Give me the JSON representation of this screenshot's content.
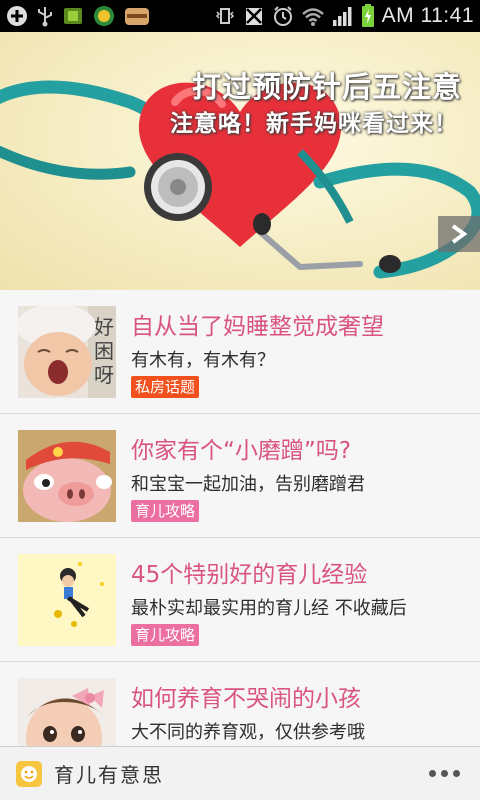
{
  "status_bar": {
    "time": "AM 11:41",
    "icons": [
      "add-icon",
      "usb-icon",
      "sim-icon",
      "app-notification-icon",
      "sandwich-app-icon",
      "vibrate-icon",
      "no-sim-icon",
      "alarm-icon",
      "wifi-icon",
      "signal-icon",
      "battery-charging-icon"
    ]
  },
  "banner": {
    "title": "打过预防针后五注意",
    "subtitle": "注意咯！新手妈咪看过来！",
    "next_icon": "chevron-right-icon"
  },
  "articles": [
    {
      "title": "自从当了妈睡整觉成奢望",
      "desc": "有木有，有木有？",
      "tag": "私房话题",
      "tag_color": "#f2501c",
      "thumb": "yawning-baby"
    },
    {
      "title": "你家有个“小磨蹭”吗?",
      "desc": "和宝宝一起加油，告别磨蹭君",
      "tag": "育儿攻略",
      "tag_color": "#ec6fa1",
      "thumb": "cartoon-pig"
    },
    {
      "title": "45个特别好的育儿经验",
      "desc": "最朴实却最实用的育儿经 不收藏后",
      "tag": "育儿攻略",
      "tag_color": "#ec6fa1",
      "thumb": "moon-boy"
    },
    {
      "title": "如何养育不哭闹的小孩",
      "desc": "大不同的养育观，仅供参考哦",
      "tag": "",
      "tag_color": "#ec6fa1",
      "thumb": "baby-with-bow"
    }
  ],
  "bottom_bar": {
    "app_name": "育儿有意思",
    "logo_icon": "smiley-logo-icon",
    "more_icon": "more-dots-icon"
  },
  "colors": {
    "accent_title": "#d9547f",
    "tag_private": "#f2501c",
    "tag_parenting": "#ec6fa1"
  }
}
